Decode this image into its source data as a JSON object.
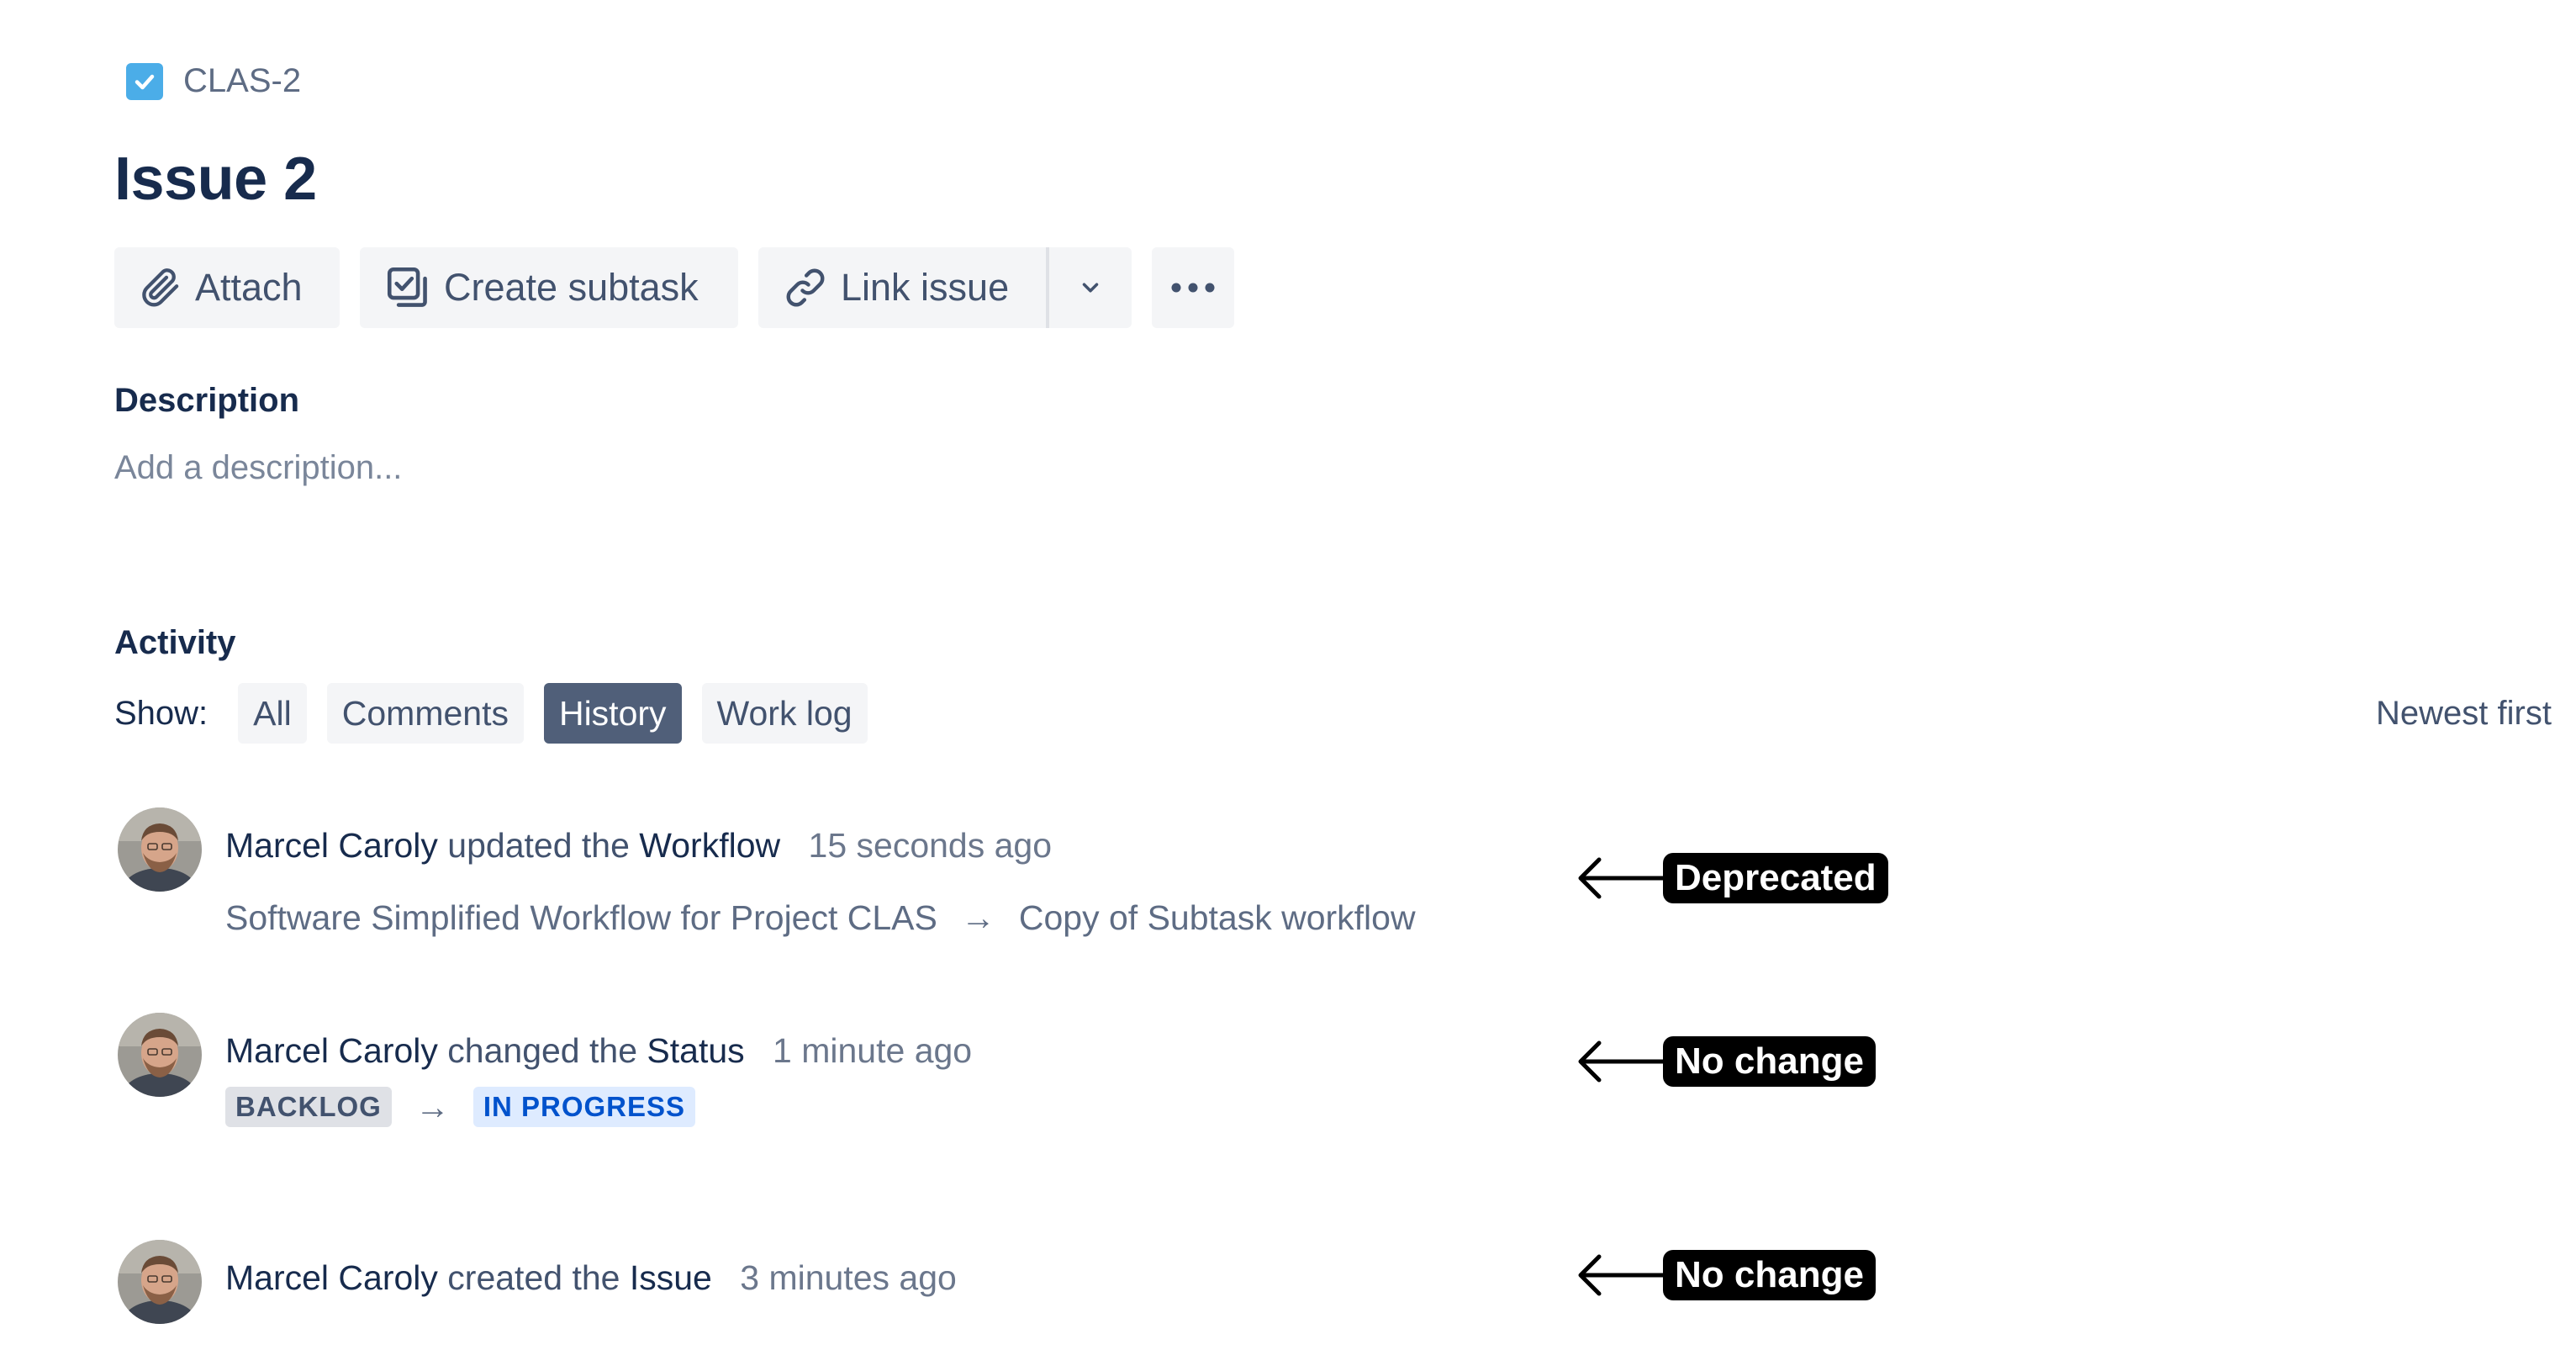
{
  "issue": {
    "key": "CLAS-2",
    "title": "Issue 2"
  },
  "toolbar": {
    "attach_label": "Attach",
    "create_subtask_label": "Create subtask",
    "link_issue_label": "Link issue"
  },
  "description": {
    "heading": "Description",
    "placeholder": "Add a description..."
  },
  "activity": {
    "heading": "Activity",
    "show_label": "Show:",
    "filters": [
      {
        "label": "All",
        "active": false
      },
      {
        "label": "Comments",
        "active": false
      },
      {
        "label": "History",
        "active": true
      },
      {
        "label": "Work log",
        "active": false
      }
    ],
    "sort_label": "Newest first"
  },
  "history": [
    {
      "user": "Marcel Caroly",
      "action": "updated the",
      "field": "Workflow",
      "time": "15 seconds ago",
      "from": "Software Simplified Workflow for Project CLAS",
      "to": "Copy of Subtask workflow",
      "arrow": "→",
      "annotation": "Deprecated"
    },
    {
      "user": "Marcel Caroly",
      "action": "changed the",
      "field": "Status",
      "time": "1 minute ago",
      "from": "BACKLOG",
      "to": "IN PROGRESS",
      "arrow": "→",
      "annotation": "No change"
    },
    {
      "user": "Marcel Caroly",
      "action": "created the",
      "field": "Issue",
      "time": "3 minutes ago",
      "annotation": "No change"
    }
  ],
  "colors": {
    "text_primary": "#172b4d",
    "text_subtle": "#42526e",
    "button_bg": "#f4f5f7",
    "active_filter_bg": "#505f79",
    "issue_type_icon": "#4bade8",
    "lozenge_inprogress": "#0052cc",
    "annotation_bg": "#000000"
  },
  "icons": {
    "issue_type": "task-checkbox-icon",
    "attach": "paperclip-icon",
    "create_subtask": "subtask-icon",
    "link_issue": "link-icon",
    "dropdown": "chevron-down-icon",
    "more": "more-horizontal-icon",
    "annotation": "arrow-left-icon"
  }
}
